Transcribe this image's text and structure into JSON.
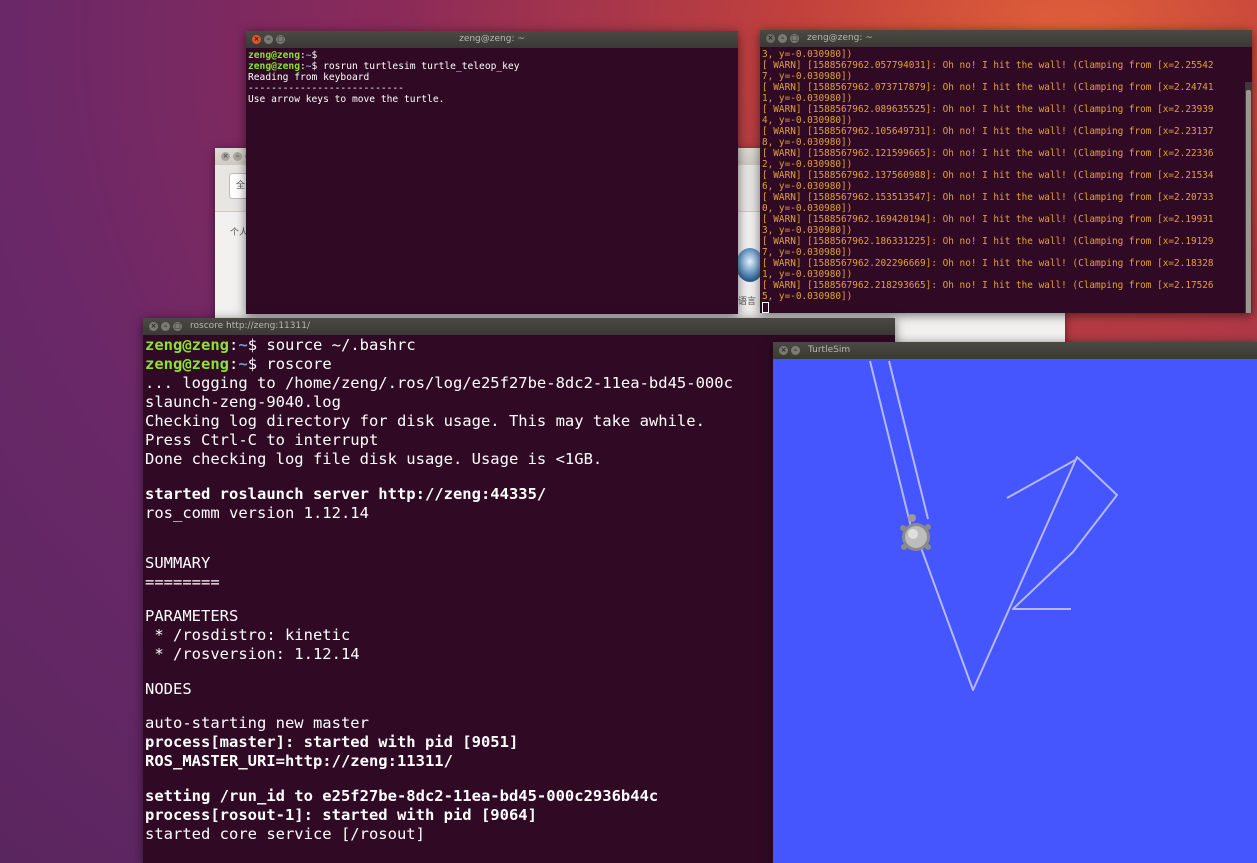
{
  "settings_window": {
    "field_text": "全",
    "label_personal": "个人",
    "label_language": "语言"
  },
  "teleop_terminal": {
    "title": "zeng@zeng: ~",
    "lines": [
      {
        "user": "zeng@zeng",
        "path": "~",
        "cmd": ""
      },
      {
        "user": "zeng@zeng",
        "path": "~",
        "cmd": " rosrun turtlesim turtle_teleop_key"
      },
      {
        "text": "Reading from keyboard"
      },
      {
        "text": "---------------------------"
      },
      {
        "text": "Use arrow keys to move the turtle."
      }
    ]
  },
  "warn_terminal": {
    "title": "zeng@zeng: ~",
    "lines": [
      "3, y=-0.030980])",
      "[ WARN] [1588567962.057794031]: Oh no! I hit the wall! (Clamping from [x=2.25542",
      "7, y=-0.030980])",
      "[ WARN] [1588567962.073717879]: Oh no! I hit the wall! (Clamping from [x=2.24741",
      "1, y=-0.030980])",
      "[ WARN] [1588567962.089635525]: Oh no! I hit the wall! (Clamping from [x=2.23939",
      "4, y=-0.030980])",
      "[ WARN] [1588567962.105649731]: Oh no! I hit the wall! (Clamping from [x=2.23137",
      "8, y=-0.030980])",
      "[ WARN] [1588567962.121599665]: Oh no! I hit the wall! (Clamping from [x=2.22336",
      "2, y=-0.030980])",
      "[ WARN] [1588567962.137560988]: Oh no! I hit the wall! (Clamping from [x=2.21534",
      "6, y=-0.030980])",
      "[ WARN] [1588567962.153513547]: Oh no! I hit the wall! (Clamping from [x=2.20733",
      "0, y=-0.030980])",
      "[ WARN] [1588567962.169420194]: Oh no! I hit the wall! (Clamping from [x=2.19931",
      "3, y=-0.030980])",
      "[ WARN] [1588567962.186331225]: Oh no! I hit the wall! (Clamping from [x=2.19129",
      "7, y=-0.030980])",
      "[ WARN] [1588567962.202296669]: Oh no! I hit the wall! (Clamping from [x=2.18328",
      "1, y=-0.030980])",
      "[ WARN] [1588567962.218293665]: Oh no! I hit the wall! (Clamping from [x=2.17526",
      "5, y=-0.030980])"
    ]
  },
  "roscore_terminal": {
    "title": "roscore http://zeng:11311/",
    "lines": [
      {
        "user": "zeng@zeng",
        "path": "~",
        "cmd": " source ~/.bashrc"
      },
      {
        "user": "zeng@zeng",
        "path": "~",
        "cmd": " roscore"
      },
      {
        "text": "... logging to /home/zeng/.ros/log/e25f27be-8dc2-11ea-bd45-000c"
      },
      {
        "text": "slaunch-zeng-9040.log"
      },
      {
        "text": "Checking log directory for disk usage. This may take awhile."
      },
      {
        "text": "Press Ctrl-C to interrupt"
      },
      {
        "text": "Done checking log file disk usage. Usage is <1GB."
      },
      {
        "text": ""
      },
      {
        "text": "started roslaunch server http://zeng:44335/",
        "bold": true
      },
      {
        "text": "ros_comm version 1.12.14"
      },
      {
        "text": ""
      },
      {
        "text": ""
      },
      {
        "text": "SUMMARY"
      },
      {
        "text": "========"
      },
      {
        "text": ""
      },
      {
        "text": "PARAMETERS"
      },
      {
        "text": " * /rosdistro: kinetic"
      },
      {
        "text": " * /rosversion: 1.12.14"
      },
      {
        "text": ""
      },
      {
        "text": "NODES"
      },
      {
        "text": ""
      },
      {
        "text": "auto-starting new master"
      },
      {
        "text": "process[master]: started with pid [9051]",
        "bold": true
      },
      {
        "text": "ROS_MASTER_URI=http://zeng:11311/",
        "bold": true
      },
      {
        "text": ""
      },
      {
        "text": "setting /run_id to e25f27be-8dc2-11ea-bd45-000c2936b44c",
        "bold": true
      },
      {
        "text": "process[rosout-1]: started with pid [9064]",
        "bold": true
      },
      {
        "text": "started core service [/rosout]"
      }
    ]
  },
  "turtlesim_window": {
    "title": "TurtleSim",
    "background_color": "#4556ff",
    "pen_color": "#b3b8ff"
  },
  "colors": {
    "terminal_bg": "#300a24",
    "prompt_user": "#8ae234",
    "prompt_path": "#729fcf",
    "warn_text": "#e0a238"
  }
}
